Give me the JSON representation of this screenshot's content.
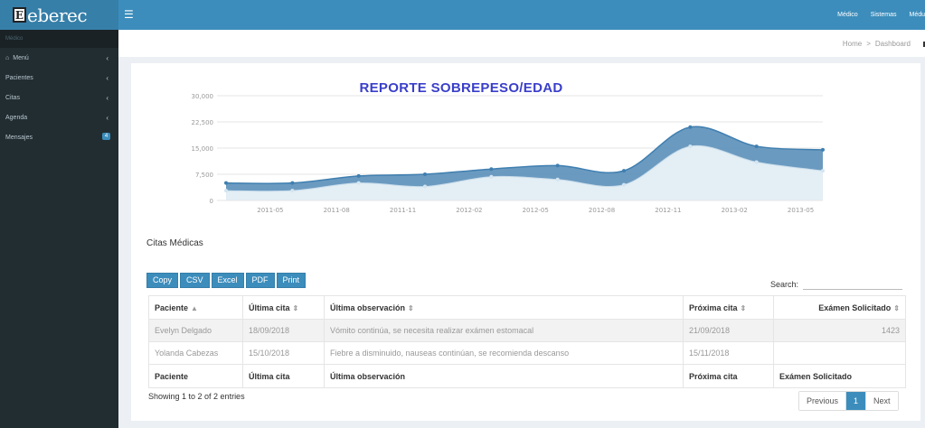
{
  "brand": {
    "logo_mark": "E",
    "logo_text": "eberec"
  },
  "topnav": [
    "Médico",
    "Sistemas",
    "Médu"
  ],
  "sidebar": {
    "header": "Médico",
    "items": [
      {
        "icon": "home-icon",
        "label": "Menú",
        "has_chevron": true
      },
      {
        "label": "Pacientes",
        "has_chevron": true
      },
      {
        "label": "Citas",
        "has_chevron": true
      },
      {
        "label": "Agenda",
        "has_chevron": true
      },
      {
        "label": "Mensajes",
        "badge": "4"
      }
    ]
  },
  "breadcrumb": {
    "home": "Home",
    "separator": ">",
    "current": "Dashboard"
  },
  "colors": {
    "primary": "#3c8dbc",
    "sidebar": "#222d32",
    "title": "#3a3fc9",
    "upper_area": "#5b8fb9",
    "lower_area": "#e3eef5"
  },
  "chart_data": {
    "type": "area",
    "title": "REPORTE SOBREPESO/EDAD",
    "y_ticks": [
      "30,000",
      "22,500",
      "15,000",
      "7,500",
      "0"
    ],
    "ylim": [
      0,
      30000
    ],
    "x_tick_labels": [
      "2011-05",
      "2011-08",
      "2011-11",
      "2012-02",
      "2012-05",
      "2012-08",
      "2012-11",
      "2013-02",
      "2013-05"
    ],
    "x_dates": [
      "2011-03",
      "2011-06",
      "2011-09",
      "2011-12",
      "2012-03",
      "2012-06",
      "2012-09",
      "2012-12",
      "2013-03",
      "2013-06"
    ],
    "series": [
      {
        "values": [
          5000,
          5000,
          7000,
          7500,
          9000,
          10000,
          8500,
          21000,
          15500,
          14500
        ]
      },
      {
        "values": [
          2800,
          2800,
          5000,
          4000,
          6800,
          6000,
          4500,
          15500,
          11000,
          8500
        ]
      }
    ],
    "grid": true
  },
  "citas": {
    "title": "Citas Médicas",
    "buttons": [
      "Copy",
      "CSV",
      "Excel",
      "PDF",
      "Print"
    ],
    "search_label": "Search:",
    "columns": [
      "Paciente",
      "Última cita",
      "Última observación",
      "Próxima cita",
      "Exámen Solicitado"
    ],
    "rows": [
      [
        "Evelyn Delgado",
        "18/09/2018",
        "Vómito continúa, se necesita realizar exámen estomacal",
        "21/09/2018",
        "1423"
      ],
      [
        "Yolanda Cabezas",
        "15/10/2018",
        "Fiebre a disminuido, nauseas continúan, se recomienda descanso",
        "15/11/2018",
        ""
      ]
    ],
    "info": "Showing 1 to 2 of 2 entries",
    "pager": {
      "previous": "Previous",
      "current": "1",
      "next": "Next"
    }
  }
}
